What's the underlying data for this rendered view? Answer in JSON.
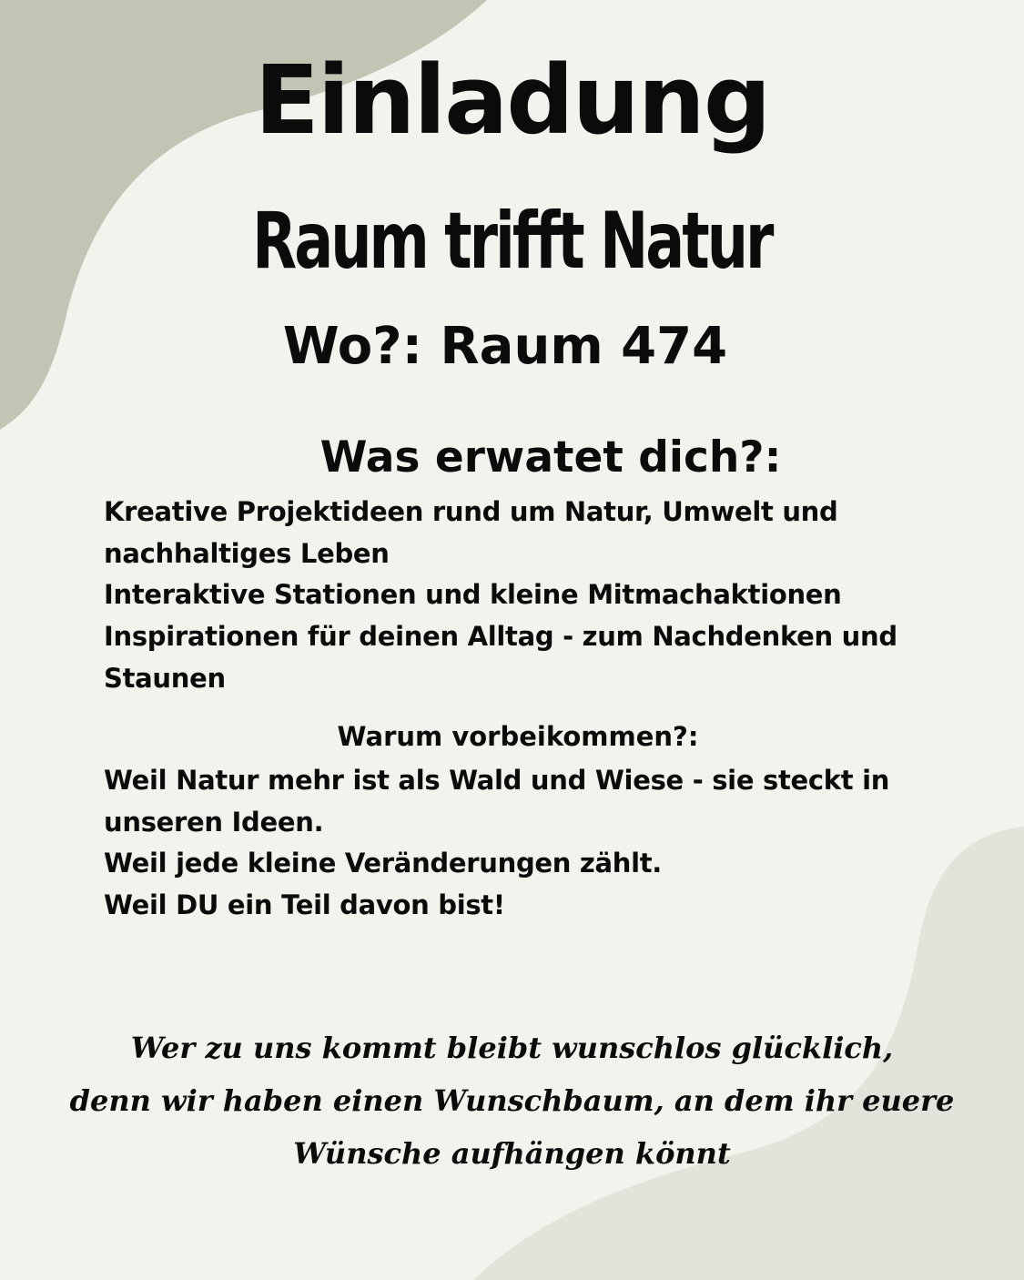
{
  "colors": {
    "background": "#f3f2ed",
    "shape_top_left": "#c2c5b3",
    "shape_bottom_right": "#e3e3dc",
    "text": "#0b0b0b"
  },
  "invitation": {
    "title": "Einladung",
    "subtitle": "Raum trifft Natur",
    "location": "Wo?: Raum 474",
    "expect_heading": "Was erwatet dich?:",
    "expect_lines": [
      "Kreative Projektideen rund um Natur, Umwelt und",
      "nachhaltiges Leben",
      "Interaktive Stationen und kleine Mitmachaktionen",
      "Inspirationen für deinen Alltag - zum Nachdenken und",
      "Staunen"
    ],
    "reasons_heading": "Warum vorbeikommen?:",
    "reasons_lines": [
      "Weil Natur mehr ist als Wald und Wiese - sie steckt in",
      "unseren Ideen.",
      "Weil jede kleine Veränderungen zählt.",
      "Weil DU ein Teil davon bist!"
    ],
    "closing_lines": [
      "Wer zu uns kommt bleibt wunschlos glücklich,",
      "denn wir haben einen Wunschbaum, an dem ihr euere",
      "Wünsche aufhängen könnt"
    ]
  }
}
